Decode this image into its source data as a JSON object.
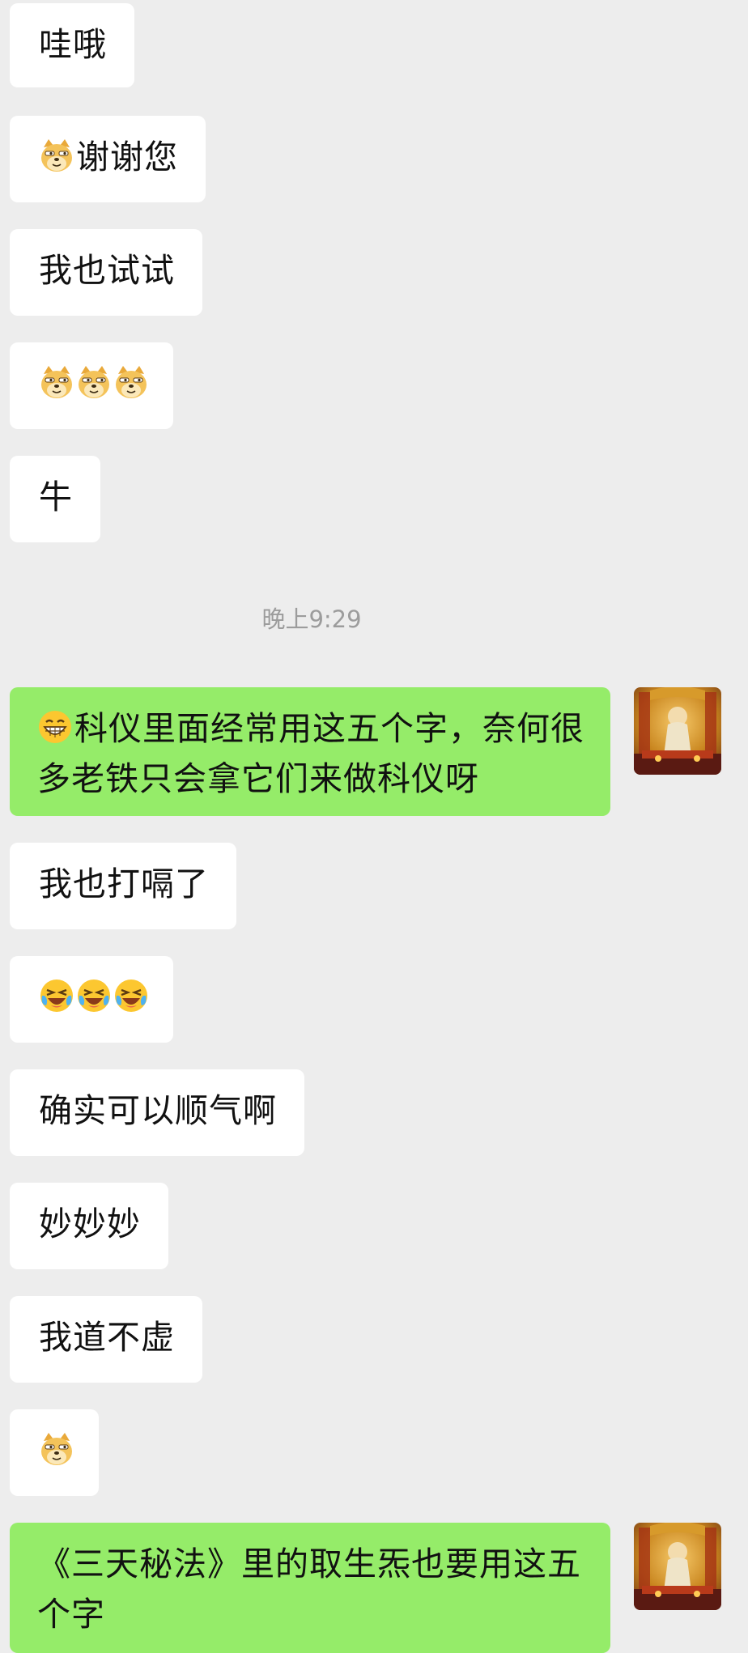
{
  "chat": {
    "timestamp": "晚上9:29",
    "messages": [
      {
        "type": "in",
        "text": "哇哦",
        "emojis": []
      },
      {
        "type": "in",
        "text": "谢谢您",
        "emojis": [
          "doge-emoji"
        ]
      },
      {
        "type": "in",
        "text": "我也试试",
        "emojis": []
      },
      {
        "type": "in",
        "text": "",
        "emojis": [
          "doge-emoji",
          "doge-emoji",
          "doge-emoji"
        ]
      },
      {
        "type": "in",
        "text": "牛",
        "emojis": []
      },
      {
        "type": "out",
        "text": "科仪里面经常用这五个字，奈何很多老铁只会拿它们来做科仪呀",
        "emojis": [
          "grin-emoji"
        ]
      },
      {
        "type": "in",
        "text": "我也打嗝了",
        "emojis": []
      },
      {
        "type": "in",
        "text": "",
        "emojis": [
          "laugh-cry-emoji",
          "laugh-cry-emoji",
          "laugh-cry-emoji"
        ]
      },
      {
        "type": "in",
        "text": "确实可以顺气啊",
        "emojis": []
      },
      {
        "type": "in",
        "text": "妙妙妙",
        "emojis": []
      },
      {
        "type": "in",
        "text": "我道不虚",
        "emojis": []
      },
      {
        "type": "in",
        "text": "",
        "emojis": [
          "doge-emoji"
        ]
      },
      {
        "type": "out",
        "text": "《三天秘法》里的取生炁也要用这五个字",
        "emojis": []
      }
    ]
  },
  "colors": {
    "background": "#ededed",
    "incoming_bubble": "#ffffff",
    "outgoing_bubble": "#95ec69",
    "timestamp_text": "#9c9c9c"
  }
}
